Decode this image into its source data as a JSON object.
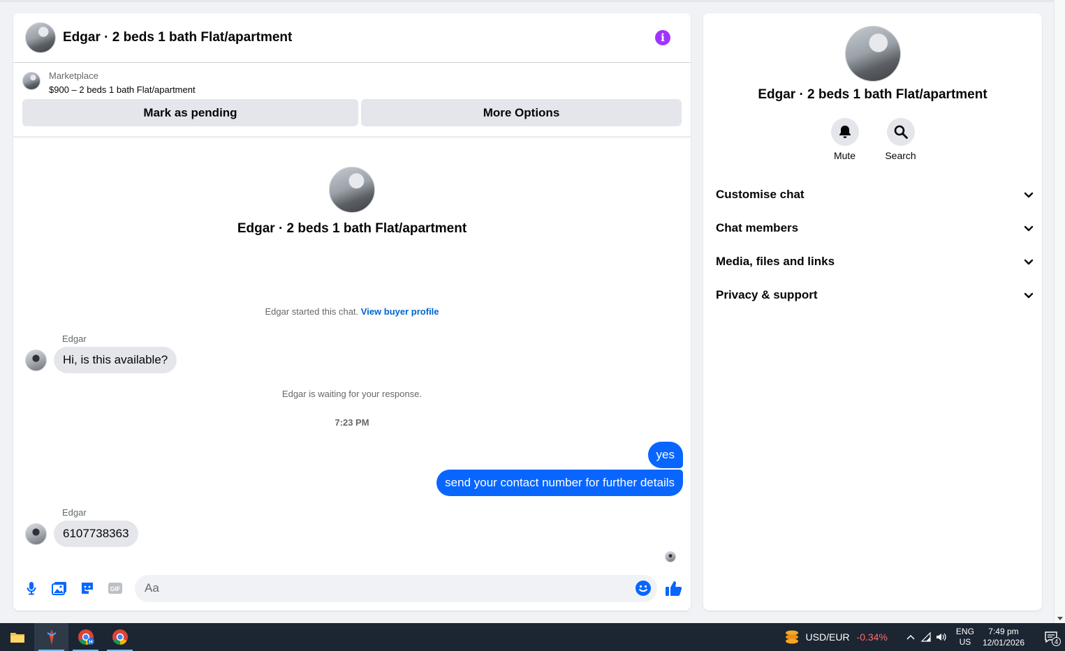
{
  "chat": {
    "header_title": "Edgar · 2 beds 1 bath Flat/apartment",
    "listing": {
      "source": "Marketplace",
      "price_title": "$900 – 2 beds 1 bath Flat/apartment",
      "mark_pending_label": "Mark as pending",
      "more_options_label": "More Options"
    },
    "intro_title": "Edgar · 2 beds 1 bath Flat/apartment",
    "started_text": "Edgar started this chat.",
    "view_profile_label": "View buyer profile",
    "messages": [
      {
        "sender": "Edgar",
        "text": "Hi, is this available?"
      },
      {
        "text": "yes"
      },
      {
        "text": "send your contact number for further details"
      },
      {
        "sender": "Edgar",
        "text": "6107738363"
      }
    ],
    "waiting_text": "Edgar is waiting for your response.",
    "timestamp": "7:23 PM",
    "composer_placeholder": "Aa"
  },
  "info": {
    "title": "Edgar · 2 beds 1 bath Flat/apartment",
    "mute_label": "Mute",
    "search_label": "Search",
    "sections": [
      "Customise chat",
      "Chat members",
      "Media, files and links",
      "Privacy & support"
    ]
  },
  "taskbar": {
    "ticker_label": "USD/EUR",
    "ticker_change": "-0.34%",
    "lang_top": "ENG",
    "lang_bottom": "US",
    "time": "7:49 pm",
    "date": "12/01/2026",
    "notification_count": "4"
  },
  "colors": {
    "accent": "#0866ff",
    "info": "#a033ff",
    "link": "#0064d1"
  }
}
